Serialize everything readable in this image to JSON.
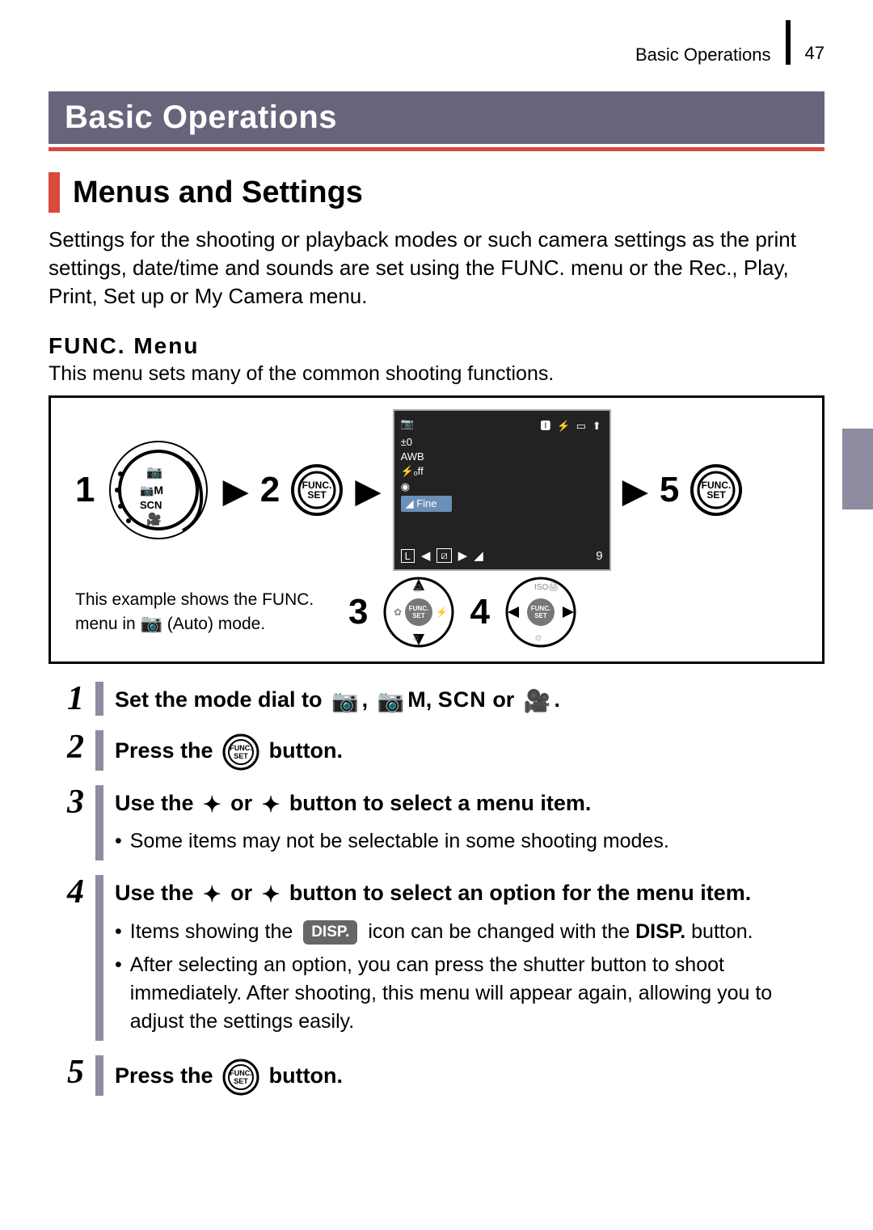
{
  "header": {
    "section": "Basic Operations",
    "page_number": "47"
  },
  "title": "Basic Operations",
  "h2": "Menus and Settings",
  "intro": "Settings for the shooting or playback modes or such camera settings as the print settings, date/time and sounds are set using the FUNC. menu or the Rec., Play, Print, Set up or My Camera menu.",
  "h3": "FUNC. Menu",
  "h3_sub": "This menu sets many of the common shooting functions.",
  "diagram": {
    "n1": "1",
    "n2": "2",
    "n3": "3",
    "n4": "4",
    "n5": "5",
    "lcd_fine": "Fine",
    "lcd_L": "L",
    "lcd_9": "9",
    "note_pre": "This example shows the FUNC. menu in ",
    "note_post": " (Auto) mode.",
    "func_label": "FUNC.",
    "set_label": "SET"
  },
  "steps": {
    "s1": {
      "pre": "Set the mode dial to ",
      "scn": "SCN",
      "or": " or ",
      "end": "."
    },
    "s2": {
      "pre": "Press the ",
      "post": " button."
    },
    "s3": {
      "pre": "Use the ",
      "mid": " or ",
      "post": " button to select a menu item.",
      "b1": "Some items may not be selectable in some shooting modes."
    },
    "s4": {
      "pre": "Use the ",
      "mid": " or ",
      "post": " button to select an option for the menu item.",
      "b1_pre": "Items showing the ",
      "b1_post": " icon can be changed with the ",
      "b1_strong": "DISP.",
      "b1_tail": " button.",
      "b2": "After selecting an option, you can press the shutter button to shoot immediately. After shooting, this menu will appear again, allowing you to adjust the settings easily."
    },
    "s5": {
      "pre": "Press the ",
      "post": " button."
    },
    "disp_badge": "DISP."
  }
}
